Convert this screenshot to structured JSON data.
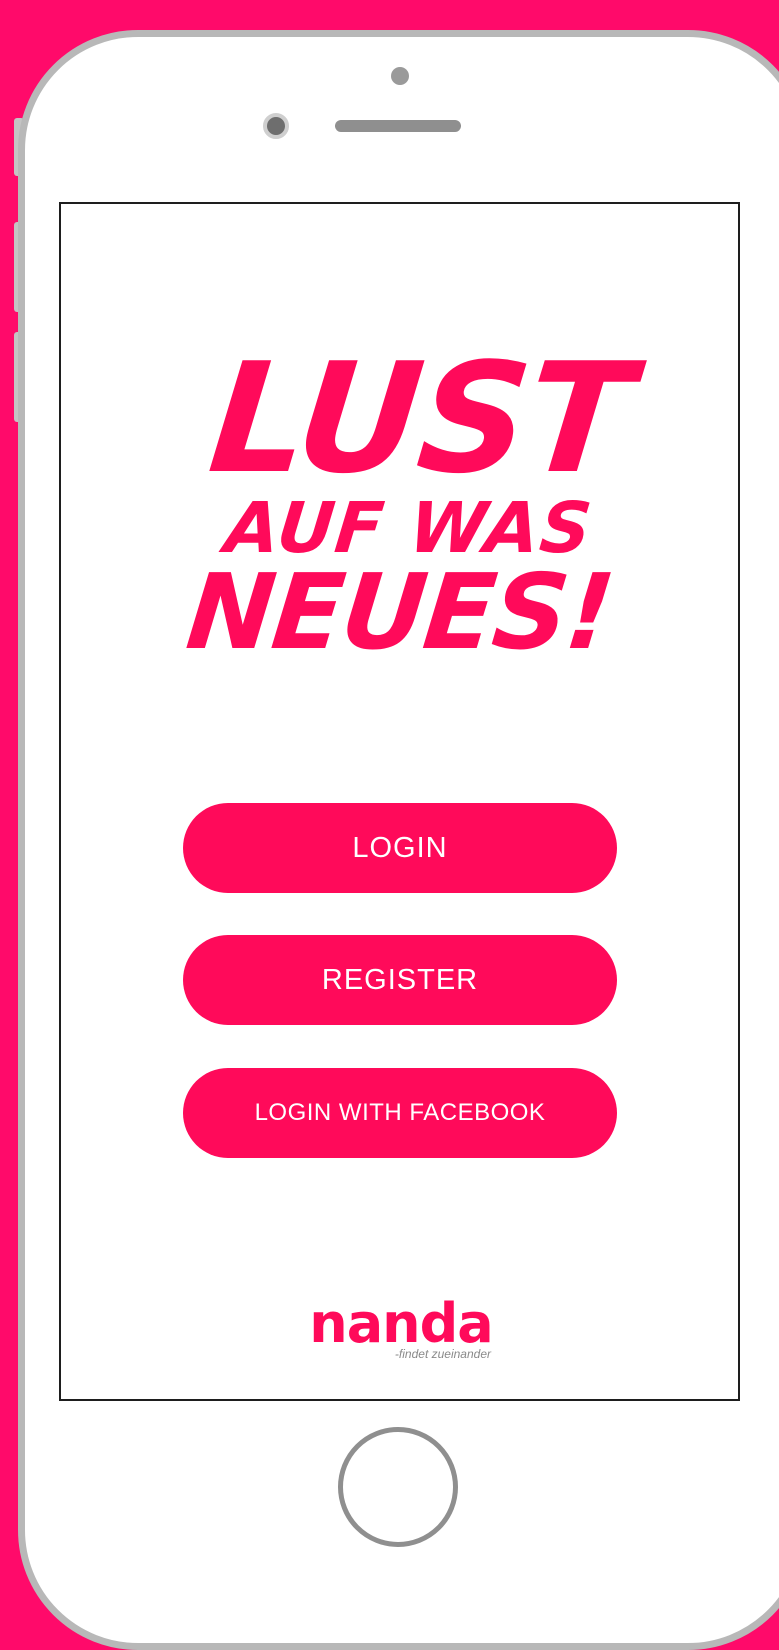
{
  "colors": {
    "accent": "#ff0a5a",
    "background": "#ff0a6a",
    "device_frame": "#b8b8b8"
  },
  "headline": {
    "line1": "LUST",
    "line2": "AUF WAS",
    "line3": "NEUES!"
  },
  "buttons": {
    "login": "LOGIN",
    "register": "REGISTER",
    "facebook": "LOGIN WITH FACEBOOK"
  },
  "brand": {
    "name": "nanda",
    "tagline": "-findet zueinander"
  }
}
